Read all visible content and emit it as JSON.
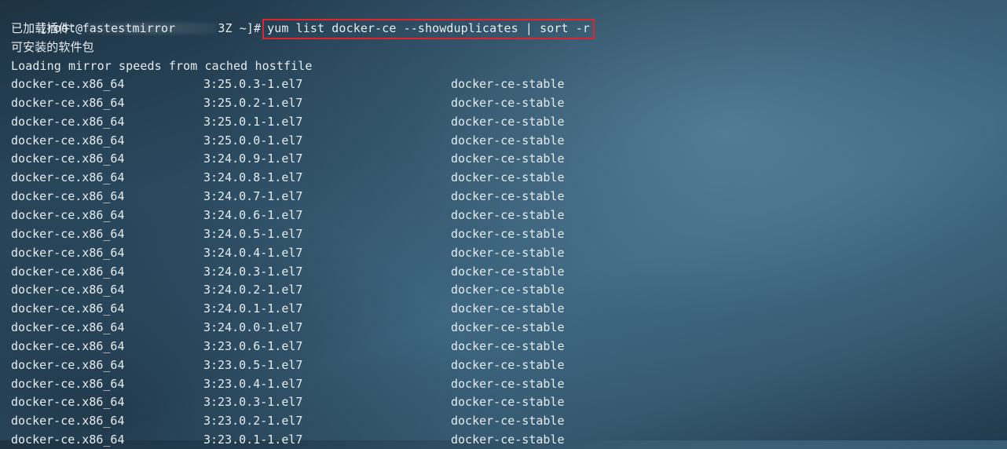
{
  "prompt": {
    "user_host_start": "[root@",
    "user_host_end": "3Z ~]#",
    "command": "yum list docker-ce --showduplicates | sort -r"
  },
  "output_lines": [
    "已加载插件：fastestmirror",
    "可安装的软件包",
    "Loading mirror speeds from cached hostfile"
  ],
  "packages": [
    {
      "name": "docker-ce.x86_64",
      "version": "3:25.0.3-1.el7",
      "repo": "docker-ce-stable"
    },
    {
      "name": "docker-ce.x86_64",
      "version": "3:25.0.2-1.el7",
      "repo": "docker-ce-stable"
    },
    {
      "name": "docker-ce.x86_64",
      "version": "3:25.0.1-1.el7",
      "repo": "docker-ce-stable"
    },
    {
      "name": "docker-ce.x86_64",
      "version": "3:25.0.0-1.el7",
      "repo": "docker-ce-stable"
    },
    {
      "name": "docker-ce.x86_64",
      "version": "3:24.0.9-1.el7",
      "repo": "docker-ce-stable"
    },
    {
      "name": "docker-ce.x86_64",
      "version": "3:24.0.8-1.el7",
      "repo": "docker-ce-stable"
    },
    {
      "name": "docker-ce.x86_64",
      "version": "3:24.0.7-1.el7",
      "repo": "docker-ce-stable"
    },
    {
      "name": "docker-ce.x86_64",
      "version": "3:24.0.6-1.el7",
      "repo": "docker-ce-stable"
    },
    {
      "name": "docker-ce.x86_64",
      "version": "3:24.0.5-1.el7",
      "repo": "docker-ce-stable"
    },
    {
      "name": "docker-ce.x86_64",
      "version": "3:24.0.4-1.el7",
      "repo": "docker-ce-stable"
    },
    {
      "name": "docker-ce.x86_64",
      "version": "3:24.0.3-1.el7",
      "repo": "docker-ce-stable"
    },
    {
      "name": "docker-ce.x86_64",
      "version": "3:24.0.2-1.el7",
      "repo": "docker-ce-stable"
    },
    {
      "name": "docker-ce.x86_64",
      "version": "3:24.0.1-1.el7",
      "repo": "docker-ce-stable"
    },
    {
      "name": "docker-ce.x86_64",
      "version": "3:24.0.0-1.el7",
      "repo": "docker-ce-stable"
    },
    {
      "name": "docker-ce.x86_64",
      "version": "3:23.0.6-1.el7",
      "repo": "docker-ce-stable"
    },
    {
      "name": "docker-ce.x86_64",
      "version": "3:23.0.5-1.el7",
      "repo": "docker-ce-stable"
    },
    {
      "name": "docker-ce.x86_64",
      "version": "3:23.0.4-1.el7",
      "repo": "docker-ce-stable"
    },
    {
      "name": "docker-ce.x86_64",
      "version": "3:23.0.3-1.el7",
      "repo": "docker-ce-stable"
    },
    {
      "name": "docker-ce.x86_64",
      "version": "3:23.0.2-1.el7",
      "repo": "docker-ce-stable"
    },
    {
      "name": "docker-ce.x86_64",
      "version": "3:23.0.1-1.el7",
      "repo": "docker-ce-stable"
    }
  ],
  "colors": {
    "highlight_border": "#e0242b",
    "text": "#e6ecef"
  }
}
